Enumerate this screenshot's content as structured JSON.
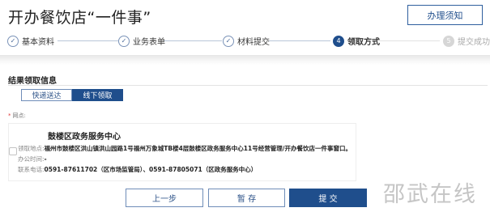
{
  "header": {
    "title": "开办餐饮店“一件事”",
    "guide_button": "办理须知"
  },
  "steps": [
    {
      "num": "✓",
      "label": "基本资料",
      "state": "done"
    },
    {
      "num": "✓",
      "label": "业务表单",
      "state": "done"
    },
    {
      "num": "✓",
      "label": "材料提交",
      "state": "done"
    },
    {
      "num": "4",
      "label": "领取方式",
      "state": "active"
    },
    {
      "num": "5",
      "label": "提交成功",
      "state": "todo"
    }
  ],
  "section": {
    "title": "结果领取信息"
  },
  "tabs": [
    {
      "label": "快递送达",
      "active": false
    },
    {
      "label": "线下领取",
      "active": true
    }
  ],
  "field": {
    "required_mark": "*",
    "label": "网点:"
  },
  "card": {
    "name": "鼓楼区政务服务中心",
    "address_key": "领取地点:",
    "address_value": "福州市鼓楼区洪山镇洪山园路1号福州万象城TB楼4层鼓楼区政务服务中心11号经营管理/开办餐饮店一件事窗口。",
    "hours_key": "办公时间:",
    "hours_value": "-",
    "phone_key": "联系电话:",
    "phone_value": "0591-87611702（区市场监管局）、0591-87805071（区政务服务中心）"
  },
  "actions": {
    "prev": "上一步",
    "save": "暂 存",
    "submit": "提 交"
  },
  "watermark": "邵武在线",
  "colors": {
    "primary": "#1f4e8c",
    "required": "#e03a3a"
  }
}
